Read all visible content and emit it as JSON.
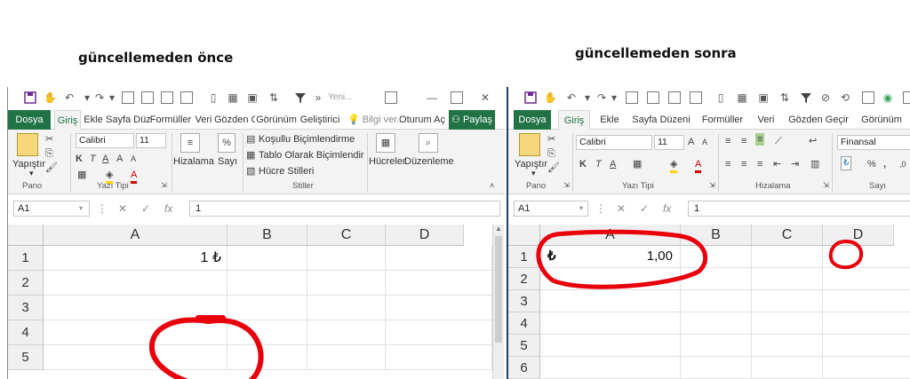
{
  "captions": {
    "before": "güncellemeden önce",
    "after": "güncellemeden sonra"
  },
  "before": {
    "qat_title": "Yeni...",
    "tabs": [
      "Dosya",
      "Giriş",
      "Ekle",
      "Sayfa Düz",
      "Formüller",
      "Veri",
      "Gözden G",
      "Görünüm",
      "Geliştirici",
      "Bilgi ver...",
      "Oturum Aç",
      "Paylaş"
    ],
    "ribbon": {
      "paste": "Yapıştır",
      "font_name": "Calibri",
      "font_size": "11",
      "alignment": "Hizalama",
      "number": "Sayı",
      "cond_format": "Koşullu Biçimlendirme",
      "format_table": "Tablo Olarak Biçimlendir",
      "cell_styles": "Hücre Stilleri",
      "cells": "Hücreler",
      "editing": "Düzenleme",
      "groups": [
        "Pano",
        "Yazı Tipi",
        "Stiller"
      ]
    },
    "name_box": "A1",
    "formula": "1",
    "columns": [
      "A",
      "B",
      "C",
      "D"
    ],
    "rows": [
      "1",
      "2",
      "3",
      "4",
      "5"
    ],
    "cell_a1": "1 ₺"
  },
  "after": {
    "tabs": [
      "Dosya",
      "Giriş",
      "Ekle",
      "Sayfa Düzeni",
      "Formüller",
      "Veri",
      "Gözden Geçir",
      "Görünüm"
    ],
    "ribbon": {
      "paste": "Yapıştır",
      "font_name": "Calibri",
      "font_size": "11",
      "number_format": "Finansal",
      "percent": "%",
      "comma": ",",
      "groups": [
        "Pano",
        "Yazı Tipi",
        "Hizalama",
        "Sayı"
      ]
    },
    "name_box": "A1",
    "formula": "1",
    "columns": [
      "A",
      "B",
      "C",
      "D"
    ],
    "rows": [
      "1",
      "2",
      "3",
      "4",
      "5",
      "6"
    ],
    "cell_a1_symbol": "₺",
    "cell_a1_value": "1,00"
  },
  "colors": {
    "excel_green": "#217346",
    "annotation_red": "#e8000b",
    "font_red": "#d00000",
    "fill_yellow": "#ffd200"
  },
  "icons": [
    "save-icon",
    "undo-icon",
    "redo-icon",
    "filter-icon",
    "paste-icon",
    "cut-icon",
    "copy-icon",
    "format-painter-icon",
    "bold-icon",
    "italic-icon",
    "underline-icon",
    "border-icon",
    "fill-color-icon",
    "font-color-icon",
    "search-icon",
    "lightbulb-icon",
    "user-icon",
    "currency-format-icon",
    "cancel-icon",
    "check-icon",
    "function-icon"
  ]
}
